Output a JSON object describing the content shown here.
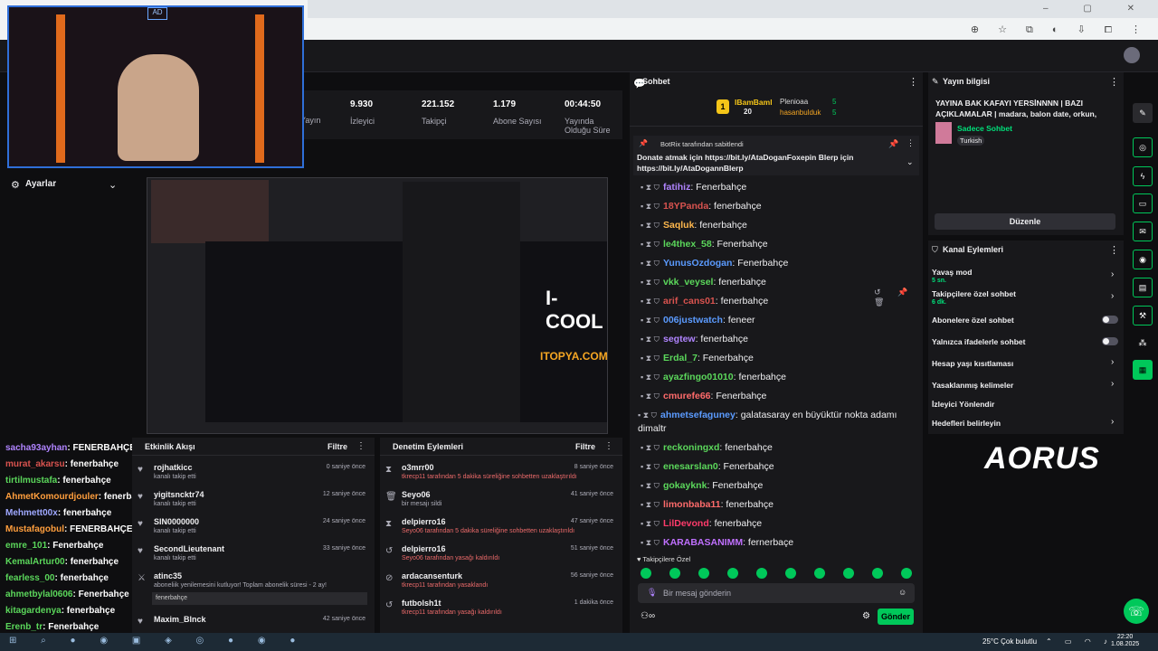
{
  "stats": [
    {
      "value": "",
      "label": "Yayın"
    },
    {
      "value": "9.930",
      "label": "İzleyici"
    },
    {
      "value": "221.152",
      "label": "Takipçi"
    },
    {
      "value": "1.179",
      "label": "Abone Sayısı"
    },
    {
      "value": "00:44:50",
      "label": "Yayında Olduğu Süre"
    }
  ],
  "settings_label": "Ayarlar",
  "preview": {
    "ad_text": "I-COOL",
    "ad_site": "ITOPYA.COM"
  },
  "left_chat": [
    {
      "user": "sacha93ayhan",
      "msg": ": FENERBAHÇE",
      "color": "#b084ff"
    },
    {
      "user": "murat_akarsu",
      "msg": ": fenerbahçe",
      "color": "#d9534f"
    },
    {
      "user": "tirtilmustafa",
      "msg": ": fenerbahçe",
      "color": "#5bd75b"
    },
    {
      "user": "AhmetKomourdjouler",
      "msg": ": fenerbahçe",
      "color": "#ff9e3d"
    },
    {
      "user": "Mehmett00x",
      "msg": ": fenerbahçe",
      "color": "#9fa8ff"
    },
    {
      "user": "Mustafagobul",
      "msg": ": FENERBAHÇEE",
      "color": "#ff9e3d"
    },
    {
      "user": "emre_101",
      "msg": ": Fenerbahçe",
      "color": "#5bd75b"
    },
    {
      "user": "KemalArtur00",
      "msg": ": fenerbahçe",
      "color": "#5bd75b"
    },
    {
      "user": "fearless_00",
      "msg": ": fenerbahçe",
      "color": "#5bd75b"
    },
    {
      "user": "ahmetbylal0606",
      "msg": ": Fenerbahçe",
      "color": "#5bd75b"
    },
    {
      "user": "kitagardenya",
      "msg": ": fenerbahçe",
      "color": "#5bd75b"
    },
    {
      "user": "Erenb_tr",
      "msg": ": Fenerbahçe",
      "color": "#5bd75b"
    }
  ],
  "activity": {
    "title": "Etkinlik Akışı",
    "filter": "Filtre",
    "items": [
      {
        "name": "rojhatkicc",
        "desc": "kanalı takip etti",
        "time": "0 saniye önce",
        "icon": "♥"
      },
      {
        "name": "yigitsncktr74",
        "desc": "kanalı takip etti",
        "time": "12 saniye önce",
        "icon": "♥"
      },
      {
        "name": "SIN0000000",
        "desc": "kanalı takip etti",
        "time": "24 saniye önce",
        "icon": "♥"
      },
      {
        "name": "SecondLieutenant",
        "desc": "kanalı takip etti",
        "time": "33 saniye önce",
        "icon": "♥"
      },
      {
        "name": "atinc35",
        "desc": "aboneliik yenilemesini kutluyor! Toplam abonelik süresi - 2 ay!",
        "time": "",
        "icon": "⚔"
      },
      {
        "name": "Maxim_Blnck",
        "desc": "",
        "time": "42 saniye önce",
        "icon": "♥"
      }
    ],
    "sub_message": "fenerbahçe"
  },
  "moderation": {
    "title": "Denetim Eylemleri",
    "filter": "Filtre",
    "items": [
      {
        "name": "o3mrr00",
        "desc": "tkrecp11 tarafından 5 dakika süreliğine sohbetten uzaklaştırıldı",
        "time": "8 saniye önce",
        "icon": "⧗"
      },
      {
        "name": "Seyo06",
        "desc": "bir mesajı sildi",
        "time": "41 saniye önce",
        "icon": "🗑"
      },
      {
        "name": "delpierro16",
        "desc": "Seyo06 tarafından 5 dakika süreliğine sohbetten uzaklaştırıldı",
        "time": "47 saniye önce",
        "icon": "⧗"
      },
      {
        "name": "delpierro16",
        "desc": "Seyo06 tarafından yasağı kaldırıldı",
        "time": "51 saniye önce",
        "icon": "↺"
      },
      {
        "name": "ardacansenturk",
        "desc": "tkrecp11 tarafından yasaklandı",
        "time": "56 saniye önce",
        "icon": "⊘"
      },
      {
        "name": "futbolsh1t",
        "desc": "tkrecp11 tarafından yasağı kaldırıldı",
        "time": "1 dakika önce",
        "icon": "↺"
      }
    ]
  },
  "chat": {
    "title": "Sohbet",
    "top_gifters": [
      {
        "name": "IBamBaml",
        "count": "20"
      },
      {
        "name": "Plenioaa",
        "count": "5"
      },
      {
        "name": "hasanbulduk",
        "count": "5"
      }
    ],
    "pinned_by": "BotRix tarafından sabitlendi",
    "pinned_text": "Donate atmak için https://bit.ly/AtaDoganFoxepin Blerp için https://bit.ly/AtaDogannBlerp",
    "messages": [
      {
        "user": "fatihiz",
        "msg": ": Fenerbahçe",
        "color": "#b084ff"
      },
      {
        "user": "18YPanda",
        "msg": ": fenerbahçe",
        "color": "#d9534f"
      },
      {
        "user": "Saqluk",
        "msg": ": fenerbahçe",
        "color": "#ffb84d"
      },
      {
        "user": "le4thex_58",
        "msg": ": Fenerbahçe",
        "color": "#5bd75b"
      },
      {
        "user": "YunusOzdogan",
        "msg": ": Fenerbahçe",
        "color": "#5b9bff"
      },
      {
        "user": "vkk_veysel",
        "msg": ": fenerbahçe",
        "color": "#5bd75b"
      },
      {
        "user": "arif_cans01",
        "msg": ": fenerbahçe",
        "color": "#d9534f"
      },
      {
        "user": "006justwatch",
        "msg": ": feneer",
        "color": "#5b9bff"
      },
      {
        "user": "segtew",
        "msg": ": fenerbahçe",
        "color": "#b084ff"
      },
      {
        "user": "Erdal_7",
        "msg": ": Fenerbahçe",
        "color": "#5bd75b"
      },
      {
        "user": "ayazfingo01010",
        "msg": ": fenerbahçe",
        "color": "#5bd75b"
      },
      {
        "user": "cmurefe66",
        "msg": ": Fenerbahçe",
        "color": "#ff6b6b"
      },
      {
        "user": "ahmetsefaguney",
        "msg": ": galatasaray en büyüktür nokta adamı dimaltr",
        "color": "#5b9bff"
      },
      {
        "user": "reckoningxd",
        "msg": ": fenerbahçe",
        "color": "#5bd75b"
      },
      {
        "user": "enesarslan0",
        "msg": ": Fenerbahçe",
        "color": "#5bd75b"
      },
      {
        "user": "gokayknk",
        "msg": ": Fenerbahçe",
        "color": "#5bd75b"
      },
      {
        "user": "limonbaba11",
        "msg": ": fenerbahçe",
        "color": "#ff6b6b"
      },
      {
        "user": "LilDevond",
        "msg": ": fenerbahçe",
        "color": "#ff3b6b"
      },
      {
        "user": "KARABASANIMM",
        "msg": ": fernerbaçe",
        "color": "#c070ff"
      }
    ],
    "followers_only": "Takipçilere Özel",
    "input_placeholder": "Bir mesaj gönderin",
    "send_label": "Gönder"
  },
  "stream_info": {
    "title": "Yayın bilgisi",
    "stream_title": "YAYINA BAK KAFAYI YERSİNNNN | BAZI AÇIKLAMALAR | madara, balon date, orkun, soğuk...",
    "category": "Sadece Sohbet",
    "language": "Turkish",
    "edit_label": "Düzenle"
  },
  "channel_actions": {
    "title": "Kanal Eylemleri",
    "items": [
      {
        "label": "Yavaş mod",
        "sub": "5 sn.",
        "kind": "chev"
      },
      {
        "label": "Takipçilere özel sohbet",
        "sub": "6 dk.",
        "kind": "chev"
      },
      {
        "label": "Abonelere özel sohbet",
        "sub": "",
        "kind": "toggle"
      },
      {
        "label": "Yalnızca ifadelerle sohbet",
        "sub": "",
        "kind": "toggle"
      },
      {
        "label": "Hesap yaşı kısıtlaması",
        "sub": "",
        "kind": "chev"
      },
      {
        "label": "Yasaklanmış kelimeler",
        "sub": "",
        "kind": "chev"
      },
      {
        "label": "İzleyici Yönlendir",
        "sub": "",
        "kind": "none"
      },
      {
        "label": "Hedefleri belirleyin",
        "sub": "",
        "kind": "chev"
      }
    ]
  },
  "brand": "AORUS",
  "taskbar": {
    "weather": "25°C Çok bulutlu",
    "time": "22:20",
    "date": "1.08.2025"
  },
  "colors": {
    "accent": "#00c85a",
    "bg": "#0e0e10",
    "panel": "#18181b"
  }
}
